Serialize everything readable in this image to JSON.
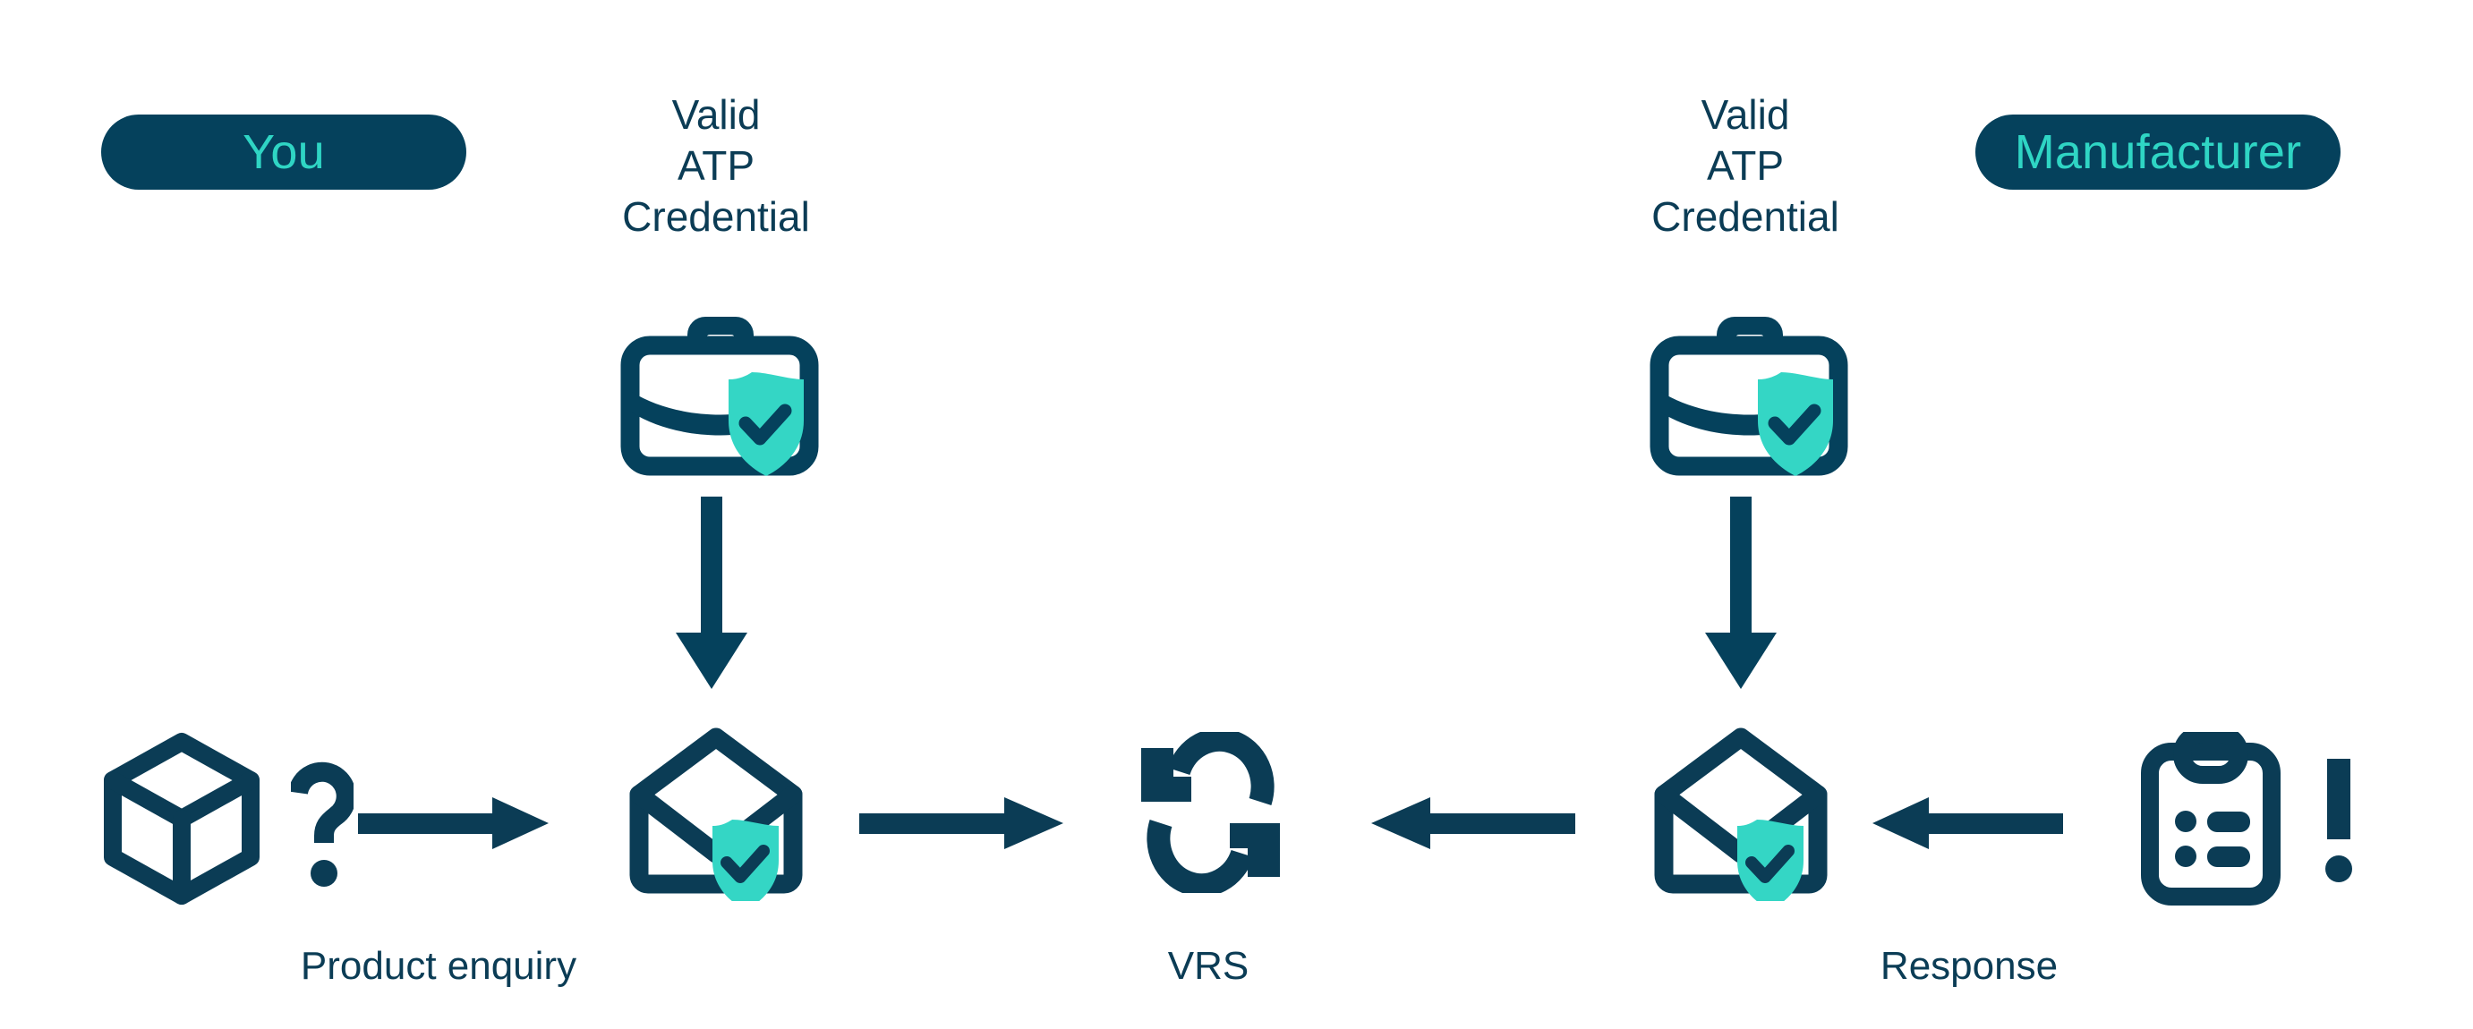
{
  "colors": {
    "navy": "#05415c",
    "navy_text": "#0b3c55",
    "teal": "#2fd5c4",
    "teal_shield": "#34d6c5",
    "background": "#ffffff"
  },
  "roles": {
    "left": {
      "label": "You"
    },
    "right": {
      "label": "Manufacturer"
    }
  },
  "credentials": {
    "left": {
      "label": "Valid\nATP\nCredential"
    },
    "right": {
      "label": "Valid\nATP\nCredential"
    }
  },
  "steps": {
    "enquiry": {
      "label": "Product enquiry"
    },
    "vrs": {
      "label": "VRS"
    },
    "response": {
      "label": "Response"
    }
  },
  "icons": {
    "briefcase_left": "briefcase-verified-icon",
    "briefcase_right": "briefcase-verified-icon",
    "cube": "product-cube-icon",
    "question": "question-mark-icon",
    "envelope_left": "envelope-verified-icon",
    "envelope_right": "envelope-verified-icon",
    "vrs": "refresh-sync-icon",
    "clipboard": "clipboard-list-icon",
    "exclaim": "exclamation-mark-icon",
    "arrow_down_left": "arrow-down-icon",
    "arrow_down_right": "arrow-down-icon",
    "arrow_right_1": "arrow-right-icon",
    "arrow_right_2": "arrow-right-icon",
    "arrow_left_1": "arrow-left-icon",
    "arrow_left_2": "arrow-left-icon"
  },
  "flow": {
    "type": "process-diagram",
    "direction_left_to_right": [
      "Product enquiry",
      "VRS"
    ],
    "direction_right_to_left": [
      "Response",
      "VRS"
    ],
    "actors": [
      "You",
      "Manufacturer"
    ]
  }
}
